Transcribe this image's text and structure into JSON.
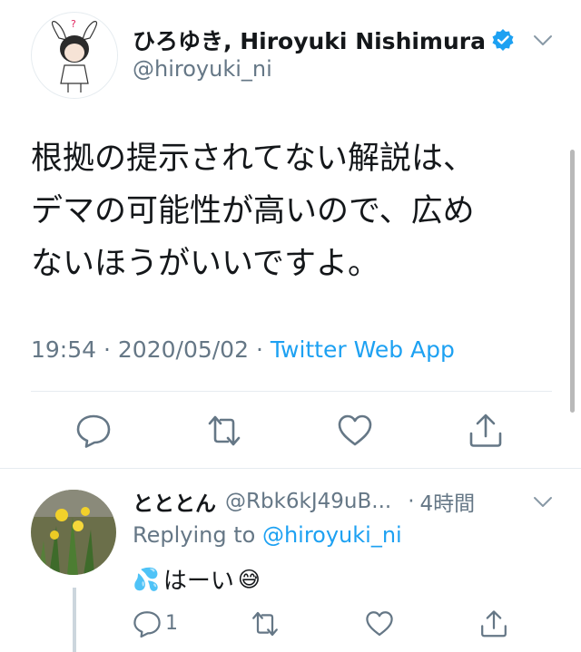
{
  "tweet": {
    "display_name": "ひろゆき, Hiroyuki Nishimura",
    "handle": "@hiroyuki_ni",
    "text_lines": [
      "根拠の提示されてない解説は、",
      "デマの可能性が高いので、広め",
      "ないほうがいいですよ。"
    ],
    "time": "19:54",
    "date": "2020/05/02",
    "separator": "·",
    "source": "Twitter Web App",
    "icons": {
      "verified": "verified-badge-icon",
      "more": "chevron-down-icon",
      "reply": "reply-icon",
      "retweet": "retweet-icon",
      "like": "heart-icon",
      "share": "share-icon"
    }
  },
  "reply": {
    "display_name": "とととん",
    "handle": "@Rbk6kJ49uB...",
    "separator": "·",
    "time": "4時間",
    "replying_prefix": "Replying to",
    "replying_to": "@hiroyuki_ni",
    "text": "はーい",
    "emoji_before": "💦",
    "emoji_after": "😅",
    "reply_count": "1"
  },
  "colors": {
    "accent": "#1da1f2",
    "muted": "#657786",
    "text": "#14171a",
    "divider": "#e6ecf0"
  }
}
